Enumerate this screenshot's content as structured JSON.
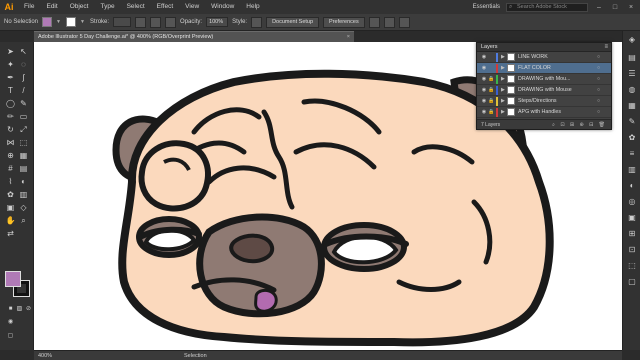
{
  "menubar": {
    "logo": "Ai",
    "items": [
      "File",
      "Edit",
      "Object",
      "Type",
      "Select",
      "Effect",
      "View",
      "Window",
      "Help"
    ],
    "workspace": "Essentials",
    "stock_placeholder": "Search Adobe Stock",
    "window_controls": [
      "–",
      "□",
      "×"
    ]
  },
  "controlbar": {
    "selection_label": "No Selection",
    "stroke_label": "Stroke:",
    "opacity_label": "Opacity:",
    "opacity_value": "100%",
    "style_label": "Style:",
    "document_setup": "Document Setup",
    "preferences": "Preferences",
    "fill_color": "#b07ab6"
  },
  "document": {
    "tab_title": "Adobe Illustrator 5 Day Challenge.ai* @ 400% (RGB/Overprint Preview)",
    "close": "×"
  },
  "layers_panel": {
    "title": "Layers",
    "rows": [
      {
        "name": "LINE WORK",
        "color": "#4f7ce0",
        "selected": false
      },
      {
        "name": "FLAT COLOR",
        "color": "#d13a3a",
        "selected": true
      },
      {
        "name": "DRAWING with Mou...",
        "color": "#3ab54a",
        "selected": false
      },
      {
        "name": "DRAWING with Mouse",
        "color": "#3a5fd1",
        "selected": false
      },
      {
        "name": "Steps/Directions",
        "color": "#e0c23a",
        "selected": false
      },
      {
        "name": "APG with Handles",
        "color": "#d13a3a",
        "selected": false
      }
    ],
    "footer_count": "7 Layers"
  },
  "statusbar": {
    "zoom": "400%",
    "tool": "Selection"
  },
  "colors": {
    "pug_skin": "#fbd9bd",
    "pug_dark": "#8f7a73",
    "outline": "#1a1a1a",
    "eye_white": "#ffffff",
    "tongue": "#b26bb0"
  }
}
